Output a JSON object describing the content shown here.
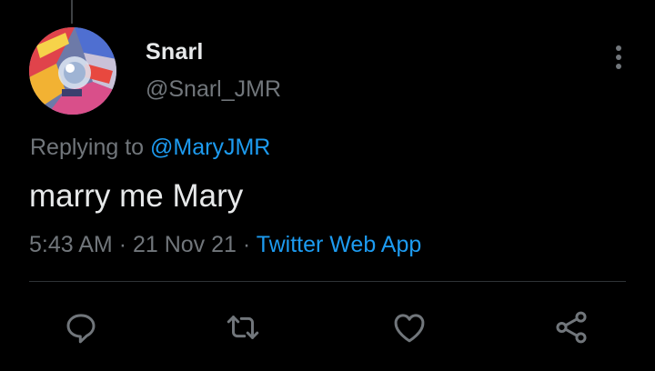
{
  "tweet": {
    "author": {
      "display_name": "Snarl",
      "handle": "@Snarl_JMR"
    },
    "replying_prefix": "Replying to",
    "replying_to": "@MaryJMR",
    "text": "marry me Mary",
    "time": "5:43 AM",
    "separator": "·",
    "date": "21 Nov 21",
    "source": "Twitter Web App"
  },
  "actions": [
    {
      "icon": "reply-icon"
    },
    {
      "icon": "retweet-icon"
    },
    {
      "icon": "like-icon"
    },
    {
      "icon": "share-icon"
    }
  ],
  "colors": {
    "background": "#000000",
    "primary_text": "#e7e9ea",
    "secondary_text": "#71767b",
    "accent": "#1d9bf0",
    "divider": "#2f3336"
  }
}
